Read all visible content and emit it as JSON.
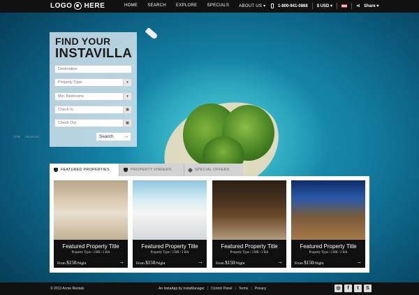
{
  "header": {
    "logo_text_left": "LOGO",
    "logo_text_right": "HERE",
    "nav": [
      "HOME",
      "SEARCH",
      "EXPLORE",
      "SPECIALS",
      "ABOUT US ▾"
    ],
    "phone": "1-800-941-0868",
    "currency": "$ USD ▾",
    "share": "Share ▾"
  },
  "search": {
    "heading_line1": "FIND YOUR",
    "heading_line2": "INSTAVILLA",
    "destination_placeholder": "Destination",
    "property_type": "Property Type",
    "bedrooms": "Min. Bedrooms",
    "check_in": "Check In",
    "check_out": "Check Out",
    "link_clear": "Clear",
    "link_advanced": "Advanced",
    "search_label": "Search"
  },
  "tabs": [
    {
      "label": "FEATURED PROPERTIES",
      "icon": "binoculars-icon",
      "active": true
    },
    {
      "label": "PROPERTY FINDERS",
      "icon": "binoculars-icon",
      "active": false
    },
    {
      "label": "SPECIAL OFFERS",
      "icon": "tag-icon",
      "active": false
    }
  ],
  "cards": [
    {
      "title": "Featured Property Title",
      "meta": "Property Type / 2 BR / 2 BA",
      "price_prefix": "From ",
      "price": "$150",
      "price_suffix": "/Night"
    },
    {
      "title": "Featured Property Title",
      "meta": "Property Type / 2 BR / 2 BA",
      "price_prefix": "From ",
      "price": "$150",
      "price_suffix": "/Night"
    },
    {
      "title": "Featured Property Title",
      "meta": "Property Type / 2 BR / 2 BA",
      "price_prefix": "From ",
      "price": "$150",
      "price_suffix": "/Night"
    },
    {
      "title": "Featured Property Title",
      "meta": "Property Type / 2 BR / 2 BA",
      "price_prefix": "From ",
      "price": "$150",
      "price_suffix": "/Night"
    }
  ],
  "footer": {
    "copyright": "© 2013  Acme Rentals",
    "app": "An InstaApp by InstaManager",
    "control_panel": "Control Panel",
    "terms": "Terms",
    "privacy": "Privacy"
  },
  "social": [
    "instagram-icon",
    "facebook-icon",
    "twitter-icon",
    "skype-icon"
  ],
  "colors": {
    "topbar": "#111111",
    "panel": "#dce8f0",
    "ocean": "#137fa3"
  }
}
